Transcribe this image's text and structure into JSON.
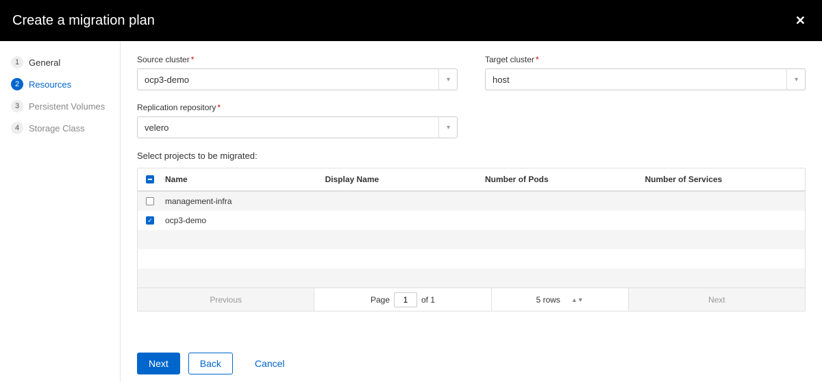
{
  "header": {
    "title": "Create a migration plan"
  },
  "steps": [
    {
      "num": "1",
      "label": "General"
    },
    {
      "num": "2",
      "label": "Resources"
    },
    {
      "num": "3",
      "label": "Persistent Volumes"
    },
    {
      "num": "4",
      "label": "Storage Class"
    }
  ],
  "active_step_index": 1,
  "form": {
    "source_cluster": {
      "label": "Source cluster",
      "value": "ocp3-demo"
    },
    "target_cluster": {
      "label": "Target cluster",
      "value": "host"
    },
    "replication_repo": {
      "label": "Replication repository",
      "value": "velero"
    },
    "projects_label": "Select projects to be migrated:"
  },
  "table": {
    "headers": {
      "name": "Name",
      "display_name": "Display Name",
      "num_pods": "Number of Pods",
      "num_services": "Number of Services"
    },
    "rows": [
      {
        "checked": false,
        "name": "management-infra",
        "display_name": "",
        "num_pods": "",
        "num_services": ""
      },
      {
        "checked": true,
        "name": "ocp3-demo",
        "display_name": "",
        "num_pods": "",
        "num_services": ""
      }
    ],
    "empty_row_count": 3,
    "pager": {
      "prev": "Previous",
      "page_label": "Page",
      "page": "1",
      "of_label": "of 1",
      "rows_label": "5 rows",
      "next": "Next"
    }
  },
  "footer": {
    "next": "Next",
    "back": "Back",
    "cancel": "Cancel"
  }
}
